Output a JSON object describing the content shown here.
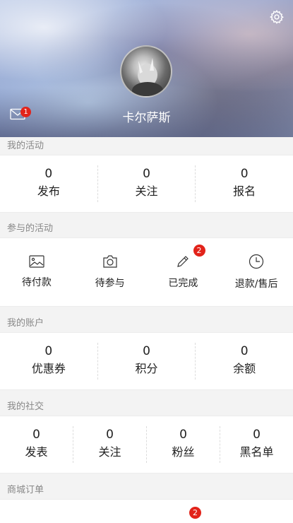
{
  "profile": {
    "username": "卡尔萨斯",
    "message_badge": "1",
    "icons": {
      "settings": "gear-icon",
      "messages": "mail-icon",
      "avatar": "avatar-image"
    }
  },
  "my_activity": {
    "title": "我的活动",
    "stats": [
      {
        "value": "0",
        "label": "发布"
      },
      {
        "value": "0",
        "label": "关注"
      },
      {
        "value": "0",
        "label": "报名"
      }
    ]
  },
  "joined_activity": {
    "title": "参与的活动",
    "items": [
      {
        "label": "待付款",
        "icon": "image-icon",
        "badge": ""
      },
      {
        "label": "待参与",
        "icon": "camera-icon",
        "badge": ""
      },
      {
        "label": "已完成",
        "icon": "pencil-icon",
        "badge": "2"
      },
      {
        "label": "退款/售后",
        "icon": "clock-icon",
        "badge": ""
      }
    ]
  },
  "my_account": {
    "title": "我的账户",
    "stats": [
      {
        "value": "0",
        "label": "优惠券"
      },
      {
        "value": "0",
        "label": "积分"
      },
      {
        "value": "0",
        "label": "余额"
      }
    ]
  },
  "my_social": {
    "title": "我的社交",
    "stats": [
      {
        "value": "0",
        "label": "发表"
      },
      {
        "value": "0",
        "label": "关注"
      },
      {
        "value": "0",
        "label": "粉丝"
      },
      {
        "value": "0",
        "label": "黑名单"
      }
    ]
  },
  "shop_orders": {
    "title": "商城订单",
    "badge": "2"
  },
  "colors": {
    "badge": "#e2231a",
    "section_text": "#888888",
    "background": "#f3f3f3"
  }
}
